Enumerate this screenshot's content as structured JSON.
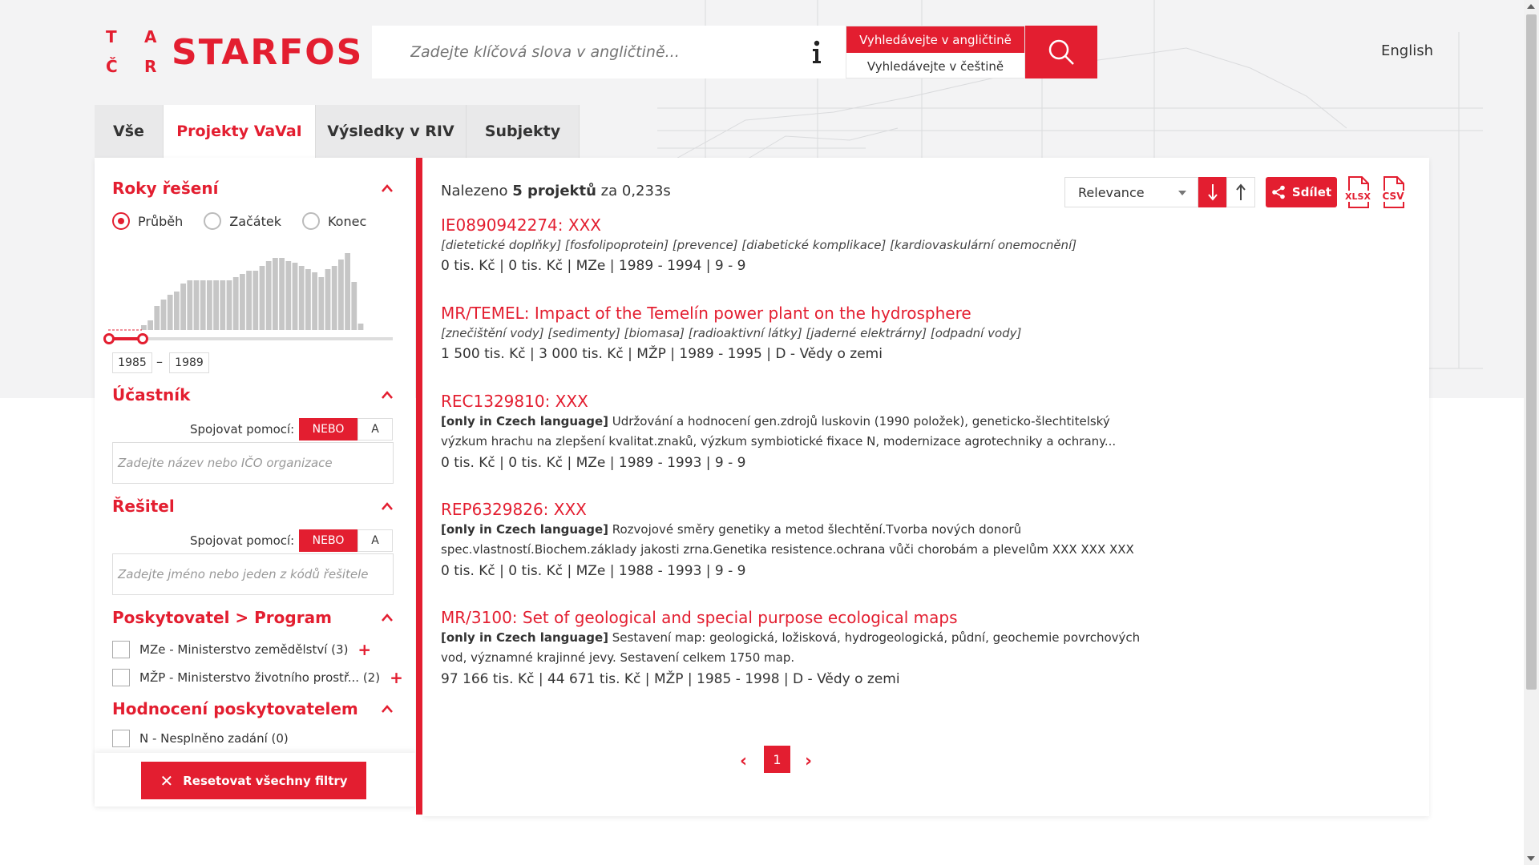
{
  "header": {
    "logo_letters": [
      "T",
      "A",
      "Č",
      "R"
    ],
    "logo_name": "STARFOS",
    "search_placeholder": "Zadejte klíčová slova v angličtině...",
    "lang_english": "Vyhledávejte v angličtině",
    "lang_czech": "Vyhledávejte v češtině",
    "language_link": "English"
  },
  "tabs": [
    {
      "label": "Vše",
      "active": false
    },
    {
      "label": "Projekty VaVaI",
      "active": true
    },
    {
      "label": "Výsledky v RIV",
      "active": false
    },
    {
      "label": "Subjekty",
      "active": false
    }
  ],
  "sidebar": {
    "years": {
      "title": "Roky řešení",
      "options": [
        "Průběh",
        "Začátek",
        "Konec"
      ],
      "selected": "Průběh",
      "from": "1985",
      "to": "1989",
      "dash": "–"
    },
    "participant": {
      "title": "Účastník",
      "join_label": "Spojovat pomocí:",
      "or": "NEBO",
      "and": "A",
      "placeholder": "Zadejte název nebo IČO organizace"
    },
    "solver": {
      "title": "Řešitel",
      "join_label": "Spojovat pomocí:",
      "or": "NEBO",
      "and": "A",
      "placeholder": "Zadejte jméno nebo jeden z kódů řešitele"
    },
    "provider": {
      "title": "Poskytovatel > Program",
      "items": [
        {
          "label": "MZe - Ministerstvo zemědělství",
          "count": "(3)"
        },
        {
          "label": "MŽP - Ministerstvo životního prostř...",
          "count": "(2)"
        }
      ]
    },
    "rating": {
      "title": "Hodnocení poskytovatelem",
      "items": [
        {
          "label": "N - Nesplněno zadání (0)"
        }
      ]
    },
    "reset_label": "Resetovat všechny filtry"
  },
  "results_header": {
    "found_prefix": "Nalezeno",
    "found_count": "5 projektů",
    "found_suffix": "za 0,233s",
    "sort_value": "Relevance",
    "share_label": "Sdílet",
    "xlsx_label": "XLSX",
    "csv_label": "CSV"
  },
  "results": [
    {
      "title": "IE0890942274: XXX",
      "keywords": "[dietetické doplňky] [fosfolipoprotein] [prevence] [diabetické komplikace] [kardiovaskulární onemocnění]",
      "meta": "0 tis. Kč | 0 tis. Kč | MZe | 1989 - 1994 | 9 - 9"
    },
    {
      "title": "MR/TEMEL: Impact of the Temelín power plant on the hydrosphere",
      "keywords": "[znečištění vody] [sedimenty] [biomasa] [radioaktivní látky] [jaderné elektrárny] [odpadní vody]",
      "meta": "1 500 tis. Kč | 3 000 tis. Kč | MŽP | 1989 - 1995 | D - Vědy o zemi"
    },
    {
      "title": "REC1329810: XXX",
      "tag": "[only in Czech language]",
      "desc_1": " Udržování a hodnocení gen.zdrojů luskovin (1990 položek), geneticko-šlechtitelský",
      "desc_2": "výzkum hrachu na zlepšení kvalitat.znaků, výzkum symbiotické fixace N, modernizace agrotechniky a ochrany...",
      "meta": "0 tis. Kč | 0 tis. Kč | MZe | 1989 - 1993 | 9 - 9"
    },
    {
      "title": "REP6329826: XXX",
      "tag": "[only in Czech language]",
      "desc_1": " Rozvojové směry genetiky a metod šlechtění.Tvorba nových donorů",
      "desc_2": "spec.vlastností.Biochem.základy jakosti zrna.Genetika resistence.ochrana vůči chorobám a plevelům XXX XXX XXX",
      "meta": "0 tis. Kč | 0 tis. Kč | MZe | 1988 - 1993 | 9 - 9"
    },
    {
      "title": "MR/3100: Set of geological and special purpose ecological maps",
      "tag": "[only in Czech language]",
      "desc_1": " Sestavení map: geologická, ložisková, hydrogeologická, půdní, geochemie povrchových",
      "desc_2": "vod, významné krajinné jevy. Sestavení celkem 1750 map.",
      "meta": "97 166 tis. Kč | 44 671 tis. Kč | MŽP | 1985 - 1998 | D - Vědy o zemi"
    }
  ],
  "pagination": {
    "current_page": "1",
    "prev": "‹",
    "next": "›"
  },
  "colors": {
    "accent": "#e31e30",
    "background_band": "#f3f3f4"
  }
}
